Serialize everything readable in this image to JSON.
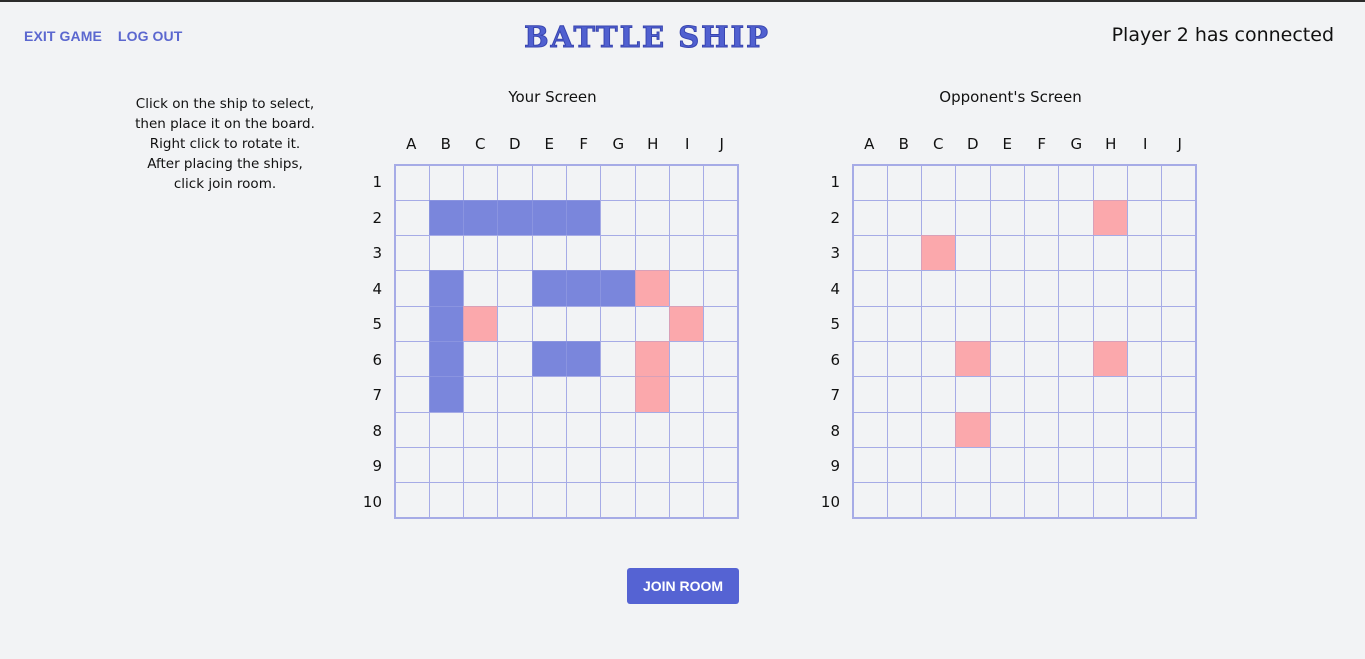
{
  "nav": {
    "exit_label": "EXIT GAME",
    "logout_label": "LOG OUT"
  },
  "logo_text": "BATTLE SHIP",
  "status_text": "Player 2 has connected",
  "instructions": [
    "Click on the ship to select,",
    "then place it on the board.",
    "Right click to rotate it.",
    "After placing the ships,",
    "click join room."
  ],
  "boards": {
    "columns": [
      "A",
      "B",
      "C",
      "D",
      "E",
      "F",
      "G",
      "H",
      "I",
      "J"
    ],
    "rows": [
      "1",
      "2",
      "3",
      "4",
      "5",
      "6",
      "7",
      "8",
      "9",
      "10"
    ],
    "player": {
      "title": "Your Screen",
      "ships": [
        "B2",
        "C2",
        "D2",
        "E2",
        "F2",
        "B4",
        "B5",
        "B6",
        "B7",
        "E4",
        "F4",
        "G4",
        "E6",
        "F6"
      ],
      "hits": [
        "H4",
        "C5",
        "I5",
        "H6",
        "H7"
      ]
    },
    "opponent": {
      "title": "Opponent's Screen",
      "ships": [],
      "hits": [
        "H2",
        "C3",
        "D6",
        "H6",
        "D8"
      ]
    }
  },
  "join_button_label": "JOIN ROOM",
  "colors": {
    "accent": "#5563d3",
    "ship": "#7a86dc",
    "hit": "#fba8ac",
    "grid": "#a6abe6"
  }
}
